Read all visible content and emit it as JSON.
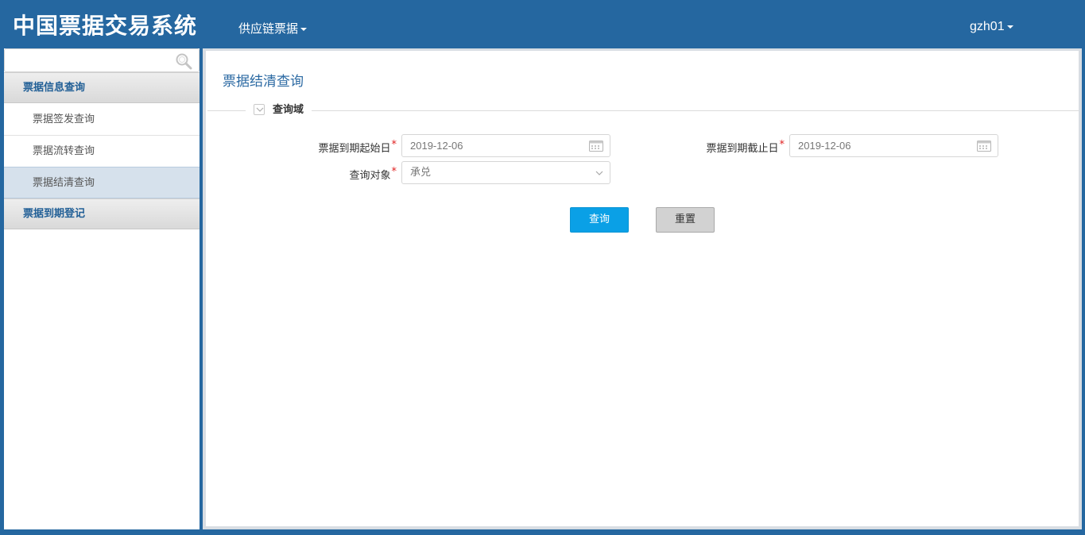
{
  "header": {
    "app_title": "中国票据交易系统",
    "menu_label": "供应链票据",
    "user_label": "gzh01"
  },
  "sidebar": {
    "search_placeholder": "",
    "groups": [
      {
        "label": "票据信息查询",
        "items": [
          {
            "label": "票据签发查询"
          },
          {
            "label": "票据流转查询"
          },
          {
            "label": "票据结清查询",
            "active": true
          }
        ]
      },
      {
        "label": "票据到期登记"
      }
    ]
  },
  "main": {
    "page_title": "票据结清查询",
    "section_label": "查询域",
    "fields": {
      "start_date": {
        "label": "票据到期起始日",
        "value": "2019-12-06",
        "required": "*"
      },
      "end_date": {
        "label": "票据到期截止日",
        "value": "2019-12-06",
        "required": "*"
      },
      "query_target": {
        "label": "查询对象",
        "value": "承兑",
        "required": "*"
      }
    },
    "buttons": {
      "query": "查询",
      "reset": "重置"
    }
  },
  "colors": {
    "header_bg": "#2567a0",
    "primary_button": "#0aa0e6",
    "title_text": "#2c6aa3",
    "required_mark": "#e02020"
  },
  "icons": [
    "search-icon",
    "calendar-icon",
    "chevron-down-icon",
    "collapse-toggle-icon",
    "caret-down-icon"
  ]
}
